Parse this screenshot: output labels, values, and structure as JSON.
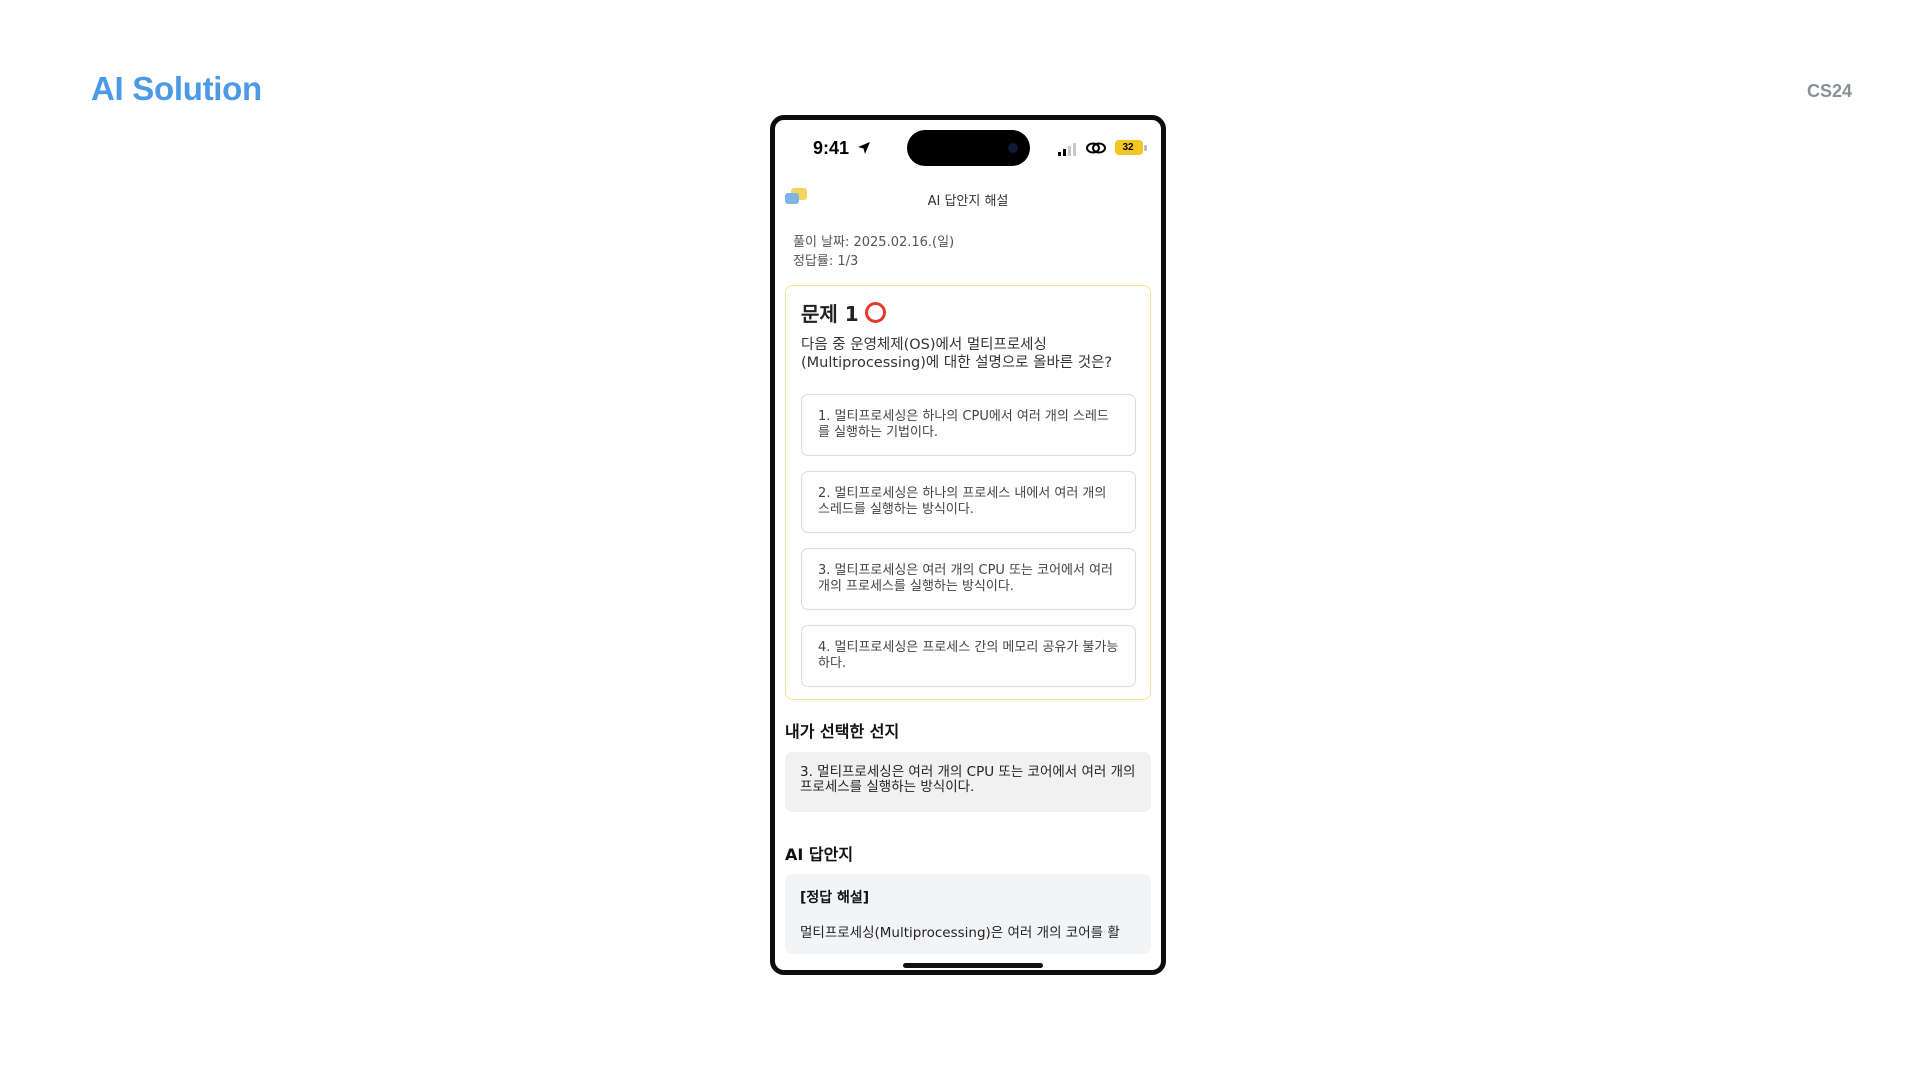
{
  "slide": {
    "title": "AI Solution",
    "tag": "CS24"
  },
  "status_bar": {
    "time": "9:41",
    "battery": "32"
  },
  "app": {
    "title": "AI 답안지 해설"
  },
  "meta": {
    "date_line": "풀이 날짜: 2025.02.16.(일)",
    "accuracy_line": "정답률: 1/3"
  },
  "question": {
    "heading": "문제 1",
    "result_mark": "correct",
    "text": "다음 중 운영체제(OS)에서 멀티프로세싱 (Multiprocessing)에 대한 설명으로 올바른 것은?",
    "options": [
      "1. 멀티프로세싱은 하나의 CPU에서 여러 개의 스레드를 실행하는 기법이다.",
      "2. 멀티프로세싱은 하나의 프로세스 내에서 여러 개의 스레드를 실행하는 방식이다.",
      "3. 멀티프로세싱은 여러 개의 CPU 또는 코어에서 여러 개의 프로세스를 실행하는 방식이다.",
      "4. 멀티프로세싱은 프로세스 간의 메모리 공유가 불가능하다."
    ]
  },
  "selected": {
    "title": "내가 선택한 선지",
    "text": "3. 멀티프로세싱은 여러 개의 CPU 또는 코어에서 여러 개의 프로세스를 실행하는 방식이다."
  },
  "ai_answer": {
    "title": "AI 답안지",
    "heading": "[정답 해설]",
    "text": "멀티프로세싱(Multiprocessing)은 여러 개의 코어를 활"
  },
  "colors": {
    "title_blue": "#4a9ae8",
    "card_border": "#f7dca0",
    "correct_mark": "#e23b2e",
    "battery": "#f3c623"
  }
}
